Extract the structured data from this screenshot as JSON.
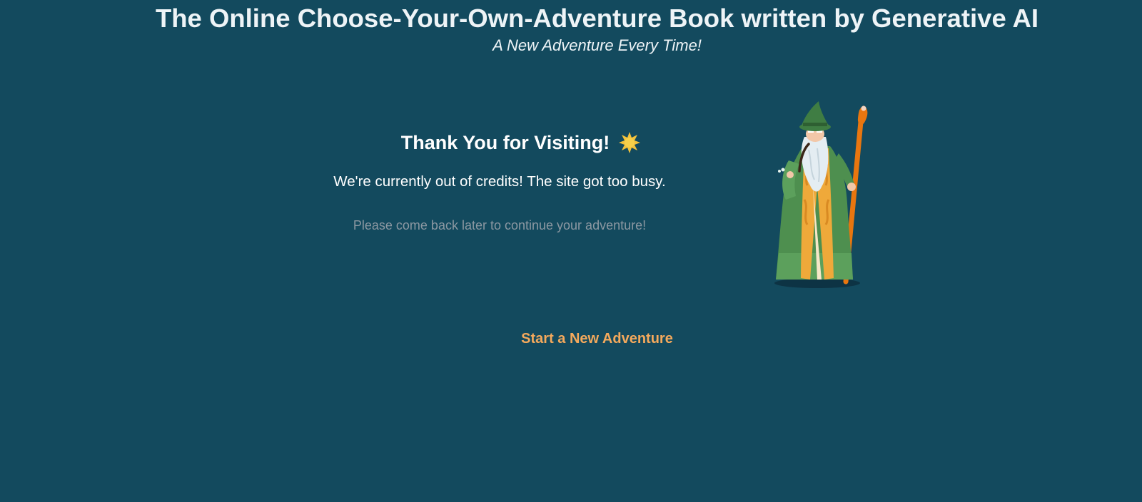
{
  "header": {
    "title": "The Online Choose-Your-Own-Adventure Book written by Generative AI",
    "tagline": "A New Adventure Every Time!"
  },
  "notice": {
    "heading": "Thank You for Visiting!",
    "heading_icon": "sparkle-icon",
    "body": "We're currently out of credits! The site got too busy.",
    "note": "Please come back later to continue your adventure!"
  },
  "illustration": {
    "name": "wizard-illustration"
  },
  "cta": {
    "label": "Start a New Adventure"
  },
  "colors": {
    "background": "#134a5e",
    "accent": "#f4a95c",
    "muted_text": "#8c98a2"
  }
}
